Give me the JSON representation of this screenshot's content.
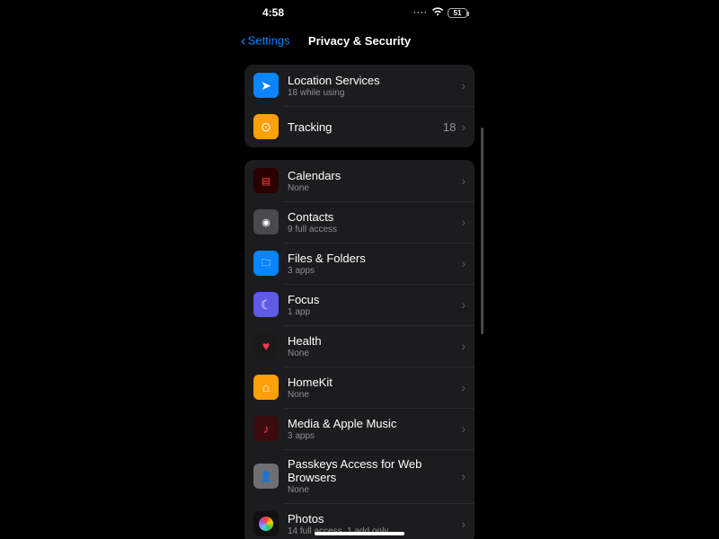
{
  "status": {
    "time": "4:58",
    "battery": "51"
  },
  "nav": {
    "back": "Settings",
    "title": "Privacy & Security"
  },
  "group1": [
    {
      "id": "location",
      "label": "Location Services",
      "sub": "18 while using",
      "trailing": ""
    },
    {
      "id": "tracking",
      "label": "Tracking",
      "sub": "",
      "trailing": "18"
    }
  ],
  "group2": [
    {
      "id": "calendars",
      "label": "Calendars",
      "sub": "None"
    },
    {
      "id": "contacts",
      "label": "Contacts",
      "sub": "9 full access"
    },
    {
      "id": "files",
      "label": "Files & Folders",
      "sub": "3 apps"
    },
    {
      "id": "focus",
      "label": "Focus",
      "sub": "1 app"
    },
    {
      "id": "health",
      "label": "Health",
      "sub": "None"
    },
    {
      "id": "homekit",
      "label": "HomeKit",
      "sub": "None"
    },
    {
      "id": "media",
      "label": "Media & Apple Music",
      "sub": "3 apps"
    },
    {
      "id": "passkeys",
      "label": "Passkeys Access for Web Browsers",
      "sub": "None"
    },
    {
      "id": "photos",
      "label": "Photos",
      "sub": "14 full access, 1 add only"
    }
  ]
}
